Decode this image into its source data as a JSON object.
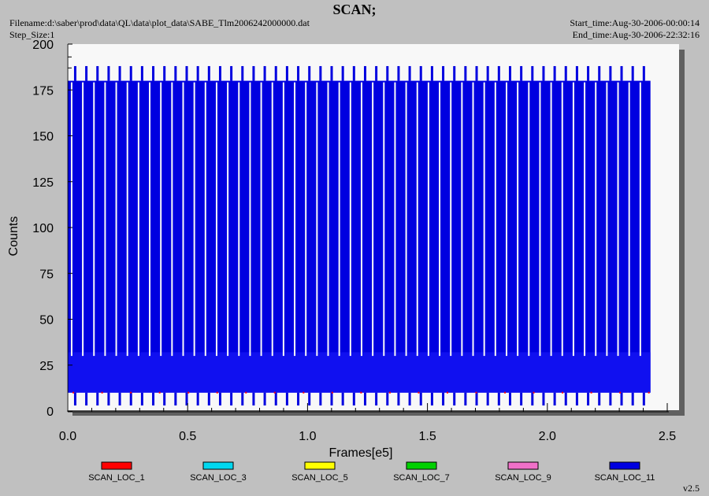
{
  "header": {
    "title": "SCAN;",
    "filename": "Filename:d:\\saber\\prod\\data\\QL\\data\\plot_data\\SABE_Tlm2006242000000.dat",
    "step_size": "Step_Size:1",
    "start_time": "Start_time:Aug-30-2006-00:00:14",
    "end_time": "End_time:Aug-30-2006-22:32:16"
  },
  "version": "v2.5",
  "colors": {
    "background": "#c0c0c0",
    "plot_area": "#f8f8f8",
    "shadow": "#606060"
  },
  "chart_data": {
    "type": "line",
    "title": "SCAN;",
    "xlabel": "Frames[e5]",
    "ylabel": "Counts",
    "xlim": [
      0,
      2.5
    ],
    "ylim": [
      0,
      200
    ],
    "x_ticks": [
      "0.0",
      "0.5",
      "1.0",
      "1.5",
      "2.0",
      "2.5"
    ],
    "y_ticks": [
      "0",
      "25",
      "50",
      "75",
      "100",
      "125",
      "150",
      "175",
      "200"
    ],
    "x_data_range": [
      0,
      2.43
    ],
    "scan_period": 0.0465,
    "grid": false,
    "legend_position": "bottom",
    "series": [
      {
        "name": "SCAN_LOC_1",
        "color": "#ff0000",
        "typical_values": [
          10
        ]
      },
      {
        "name": "SCAN_LOC_3",
        "color": "#00d8f0",
        "typical_values": []
      },
      {
        "name": "SCAN_LOC_5",
        "color": "#ffff00",
        "typical_values": []
      },
      {
        "name": "SCAN_LOC_7",
        "color": "#00d000",
        "typical_values": []
      },
      {
        "name": "SCAN_LOC_9",
        "color": "#f070c8",
        "typical_values": []
      },
      {
        "name": "SCAN_LOC_11",
        "color": "#0000e0",
        "typical_values": [
          3,
          10,
          20,
          30,
          180,
          188
        ]
      }
    ]
  }
}
